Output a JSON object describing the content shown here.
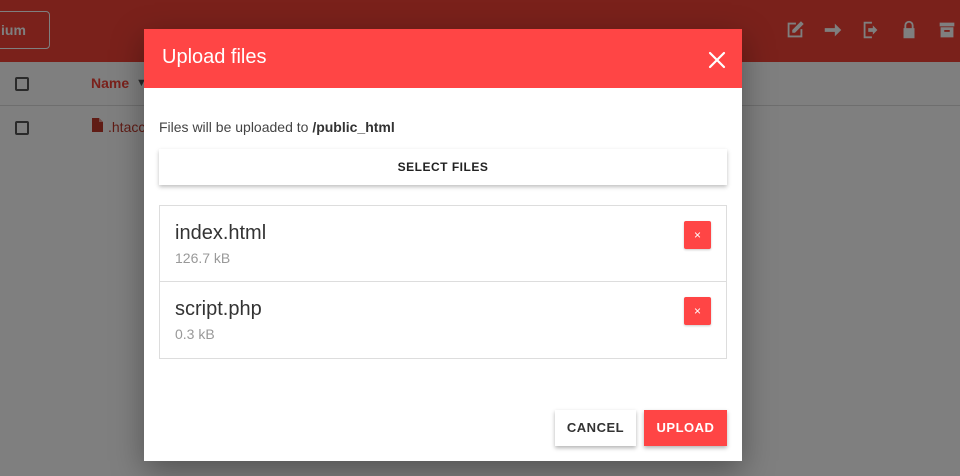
{
  "app": {
    "search_text": "ium",
    "header": {
      "column_name": "Name",
      "sort_glyph": "▼"
    },
    "rows": [
      {
        "name": ".htacc"
      }
    ],
    "top_icons": [
      "edit-icon",
      "arrow-right-icon",
      "logout-icon",
      "lock-icon",
      "archive-icon"
    ],
    "accent_color": "#f44336"
  },
  "dialog": {
    "title": "Upload files",
    "destination_prefix": "Files will be uploaded to",
    "destination_path": "/public_html",
    "select_files_label": "SELECT FILES",
    "files": [
      {
        "name": "index.html",
        "size": "126.7 kB",
        "remove_label": "×"
      },
      {
        "name": "script.php",
        "size": "0.3 kB",
        "remove_label": "×"
      }
    ],
    "cancel_label": "CANCEL",
    "upload_label": "UPLOAD",
    "header_color": "#ff4545"
  }
}
